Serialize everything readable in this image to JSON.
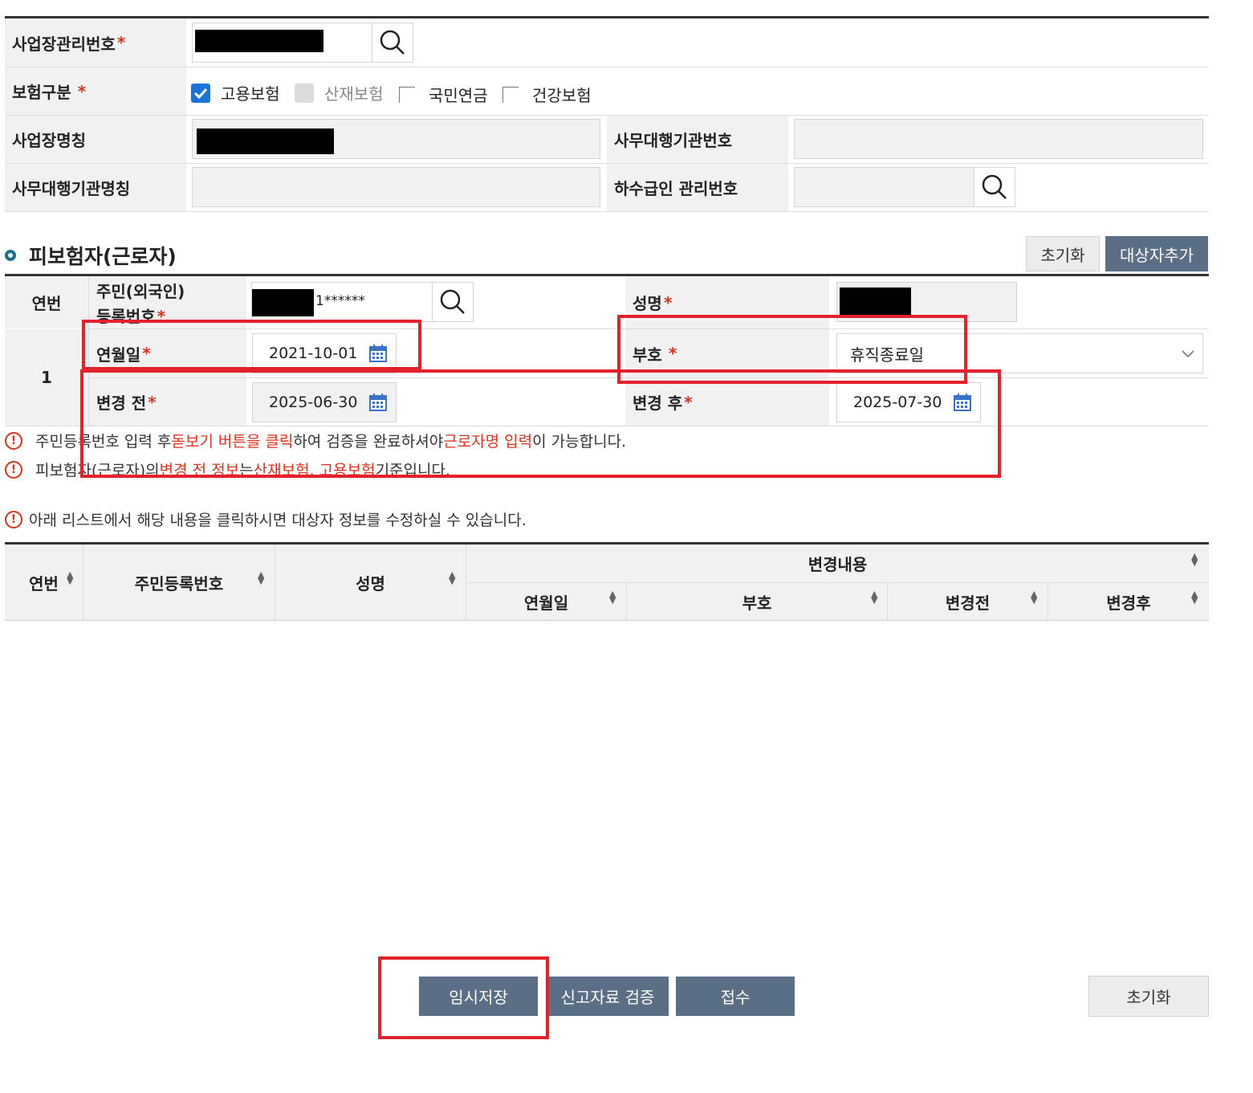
{
  "business": {
    "mgmt_no_label": "사업장관리번호",
    "insurance_type_label": "보험구분",
    "insurance_options": [
      {
        "label": "고용보험",
        "state": "checked"
      },
      {
        "label": "산재보험",
        "state": "disabled"
      },
      {
        "label": "국민연금",
        "state": "unchecked"
      },
      {
        "label": "건강보험",
        "state": "unchecked"
      }
    ],
    "name_label": "사업장명칭",
    "agency_no_label": "사무대행기관번호",
    "agency_name_label": "사무대행기관명칭",
    "subcontractor_label": "하수급인 관리번호",
    "required_mark": "*"
  },
  "section": {
    "title": "피보험자(근로자)",
    "reset_label": "초기화",
    "add_target_label": "대상자추가"
  },
  "form": {
    "seq_header": "연번",
    "seq_value": "1",
    "rrn_label": "주민(외국인)\n등록번호",
    "rrn_suffix": "1******",
    "name_label": "성명",
    "date_label": "연월일",
    "date_value": "2021-10-01",
    "code_label": "부호",
    "code_value": "휴직종료일",
    "before_label": "변경 전",
    "before_value": "2025-06-30",
    "after_label": "변경 후",
    "after_value": "2025-07-30"
  },
  "notices": {
    "n1": [
      "주민등록번호 입력 후 ",
      "돋보기 버튼을 클릭",
      "하여 검증을 완료하셔야 ",
      "근로자명 입력",
      "이 가능합니다."
    ],
    "n2": [
      "피보험자(근로자)의 ",
      "변경 전 정보",
      "는 ",
      "산재보험, 고용보험",
      " 기준입니다."
    ],
    "n3": "아래 리스트에서 해당 내용을 클릭하시면 대상자 정보를 수정하실 수 있습니다.",
    "icon_glyph": "!"
  },
  "list_table": {
    "headers": {
      "seq": "연번",
      "rrn": "주민등록번호",
      "name": "성명",
      "change_group": "변경내용",
      "date": "연월일",
      "code": "부호",
      "before": "변경전",
      "after": "변경후"
    }
  },
  "bottom_buttons": {
    "temp_save": "임시저장",
    "validate": "신고자료 검증",
    "submit": "접수",
    "reset": "초기화"
  },
  "colors": {
    "accent_red": "#e3222c",
    "slate_button": "#5a6e86",
    "checkbox_blue": "#1a73d9"
  }
}
